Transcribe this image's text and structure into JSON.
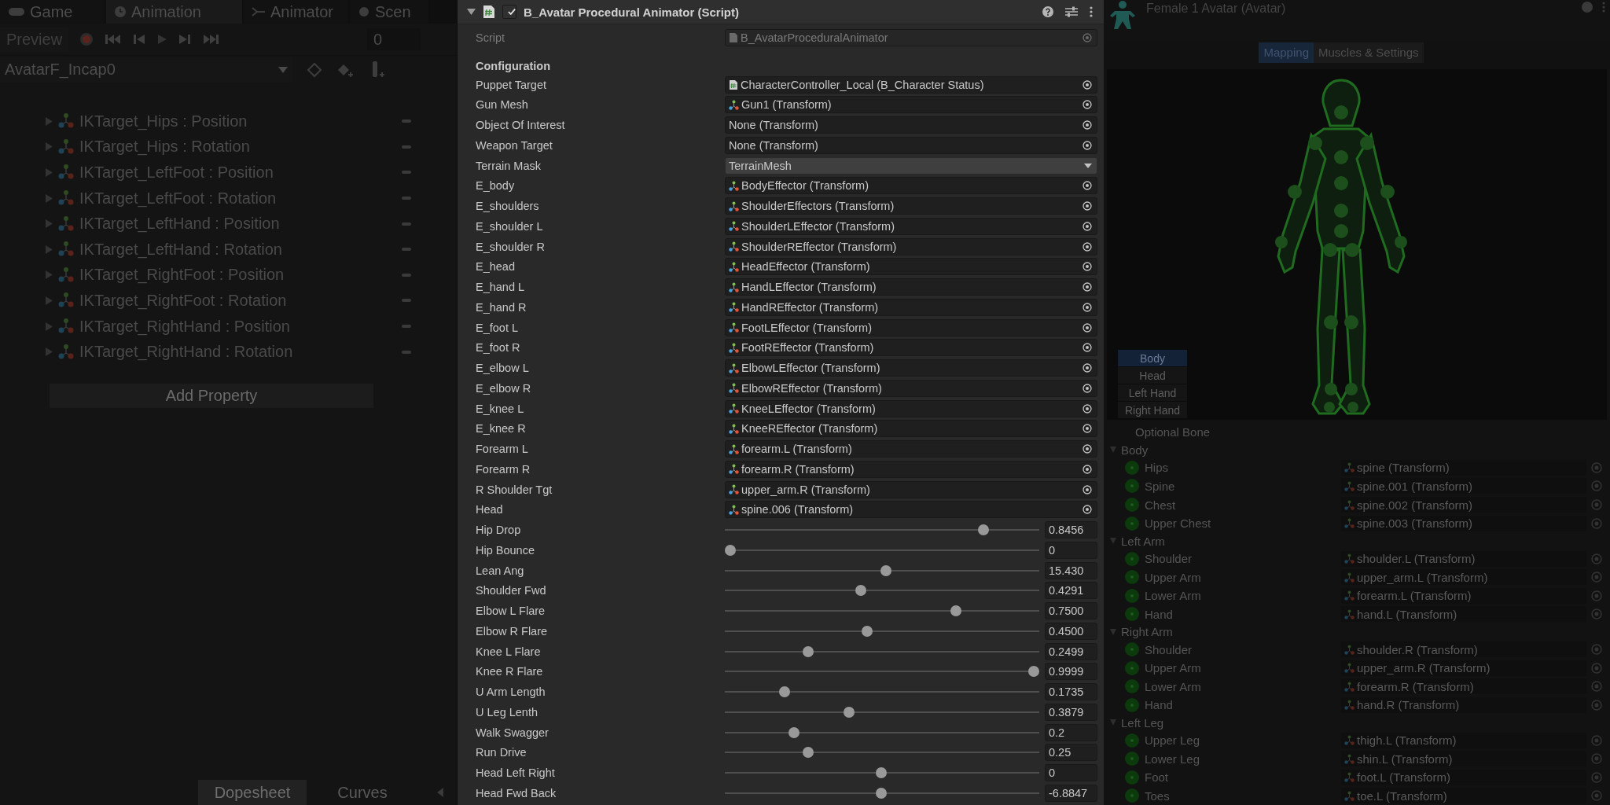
{
  "left_panel": {
    "tabs": [
      {
        "label": "Game",
        "selected": false
      },
      {
        "label": "Animation",
        "selected": true
      },
      {
        "label": "Animator",
        "selected": false
      },
      {
        "label": "Scen",
        "selected": false
      }
    ],
    "preview": "Preview",
    "frame": "0",
    "clip": "AvatarF_Incap0",
    "properties": [
      "IKTarget_Hips : Position",
      "IKTarget_Hips : Rotation",
      "IKTarget_LeftFoot : Position",
      "IKTarget_LeftFoot : Rotation",
      "IKTarget_LeftHand : Position",
      "IKTarget_LeftHand : Rotation",
      "IKTarget_RightFoot : Position",
      "IKTarget_RightFoot : Rotation",
      "IKTarget_RightHand : Position",
      "IKTarget_RightHand : Rotation"
    ],
    "add_property": "Add Property",
    "bottom_tabs": [
      {
        "label": "Dopesheet",
        "selected": true
      },
      {
        "label": "Curves",
        "selected": false
      }
    ]
  },
  "inspector": {
    "title": "B_Avatar Procedural Animator (Script)",
    "enabled": true,
    "script_label": "Script",
    "script_value": "B_AvatarProceduralAnimator",
    "section": "Configuration",
    "fields": [
      {
        "label": "Puppet Target",
        "kind": "script_ref",
        "value": "CharacterController_Local (B_Character Status)"
      },
      {
        "label": "Gun Mesh",
        "kind": "transform_ref",
        "value": "Gun1 (Transform)"
      },
      {
        "label": "Object Of Interest",
        "kind": "ref",
        "value": "None (Transform)"
      },
      {
        "label": "Weapon Target",
        "kind": "ref",
        "value": "None (Transform)"
      },
      {
        "label": "Terrain Mask",
        "kind": "dropdown",
        "value": "TerrainMesh"
      },
      {
        "label": "E_body",
        "kind": "transform_ref",
        "value": "BodyEffector (Transform)"
      },
      {
        "label": "E_shoulders",
        "kind": "transform_ref",
        "value": "ShoulderEffectors (Transform)"
      },
      {
        "label": "E_shoulder L",
        "kind": "transform_ref",
        "value": "ShoulderLEffector (Transform)"
      },
      {
        "label": "E_shoulder R",
        "kind": "transform_ref",
        "value": "ShoulderREffector (Transform)"
      },
      {
        "label": "E_head",
        "kind": "transform_ref",
        "value": "HeadEffector (Transform)"
      },
      {
        "label": "E_hand L",
        "kind": "transform_ref",
        "value": "HandLEffector (Transform)"
      },
      {
        "label": "E_hand R",
        "kind": "transform_ref",
        "value": "HandREffector (Transform)"
      },
      {
        "label": "E_foot L",
        "kind": "transform_ref",
        "value": "FootLEffector (Transform)"
      },
      {
        "label": "E_foot R",
        "kind": "transform_ref",
        "value": "FootREffector (Transform)"
      },
      {
        "label": "E_elbow L",
        "kind": "transform_ref",
        "value": "ElbowLEffector (Transform)"
      },
      {
        "label": "E_elbow R",
        "kind": "transform_ref",
        "value": "ElbowREffector (Transform)"
      },
      {
        "label": "E_knee L",
        "kind": "transform_ref",
        "value": "KneeLEffector (Transform)"
      },
      {
        "label": "E_knee R",
        "kind": "transform_ref",
        "value": "KneeREffector (Transform)"
      },
      {
        "label": "Forearm L",
        "kind": "transform_ref",
        "value": "forearm.L (Transform)"
      },
      {
        "label": "Forearm R",
        "kind": "transform_ref",
        "value": "forearm.R (Transform)"
      },
      {
        "label": "R Shoulder Tgt",
        "kind": "transform_ref",
        "value": "upper_arm.R (Transform)"
      },
      {
        "label": "Head",
        "kind": "transform_ref",
        "value": "spine.006 (Transform)"
      },
      {
        "label": "Hip Drop",
        "kind": "slider",
        "level": 0.833,
        "value": "0.8456"
      },
      {
        "label": "Hip Bounce",
        "kind": "slider",
        "level": 0,
        "value": "0"
      },
      {
        "label": "Lean Ang",
        "kind": "slider",
        "level": 0.513,
        "value": "15.430"
      },
      {
        "label": "Shoulder Fwd",
        "kind": "slider",
        "level": 0.43,
        "value": "0.4291"
      },
      {
        "label": "Elbow L Flare",
        "kind": "slider",
        "level": 0.743,
        "value": "0.7500"
      },
      {
        "label": "Elbow R Flare",
        "kind": "slider",
        "level": 0.45,
        "value": "0.4500"
      },
      {
        "label": "Knee L Flare",
        "kind": "slider",
        "level": 0.257,
        "value": "0.2499"
      },
      {
        "label": "Knee R Flare",
        "kind": "slider",
        "level": 1,
        "value": "0.9999"
      },
      {
        "label": "U Arm Length",
        "kind": "slider",
        "level": 0.18,
        "value": "0.1735"
      },
      {
        "label": "U Leg Lenth",
        "kind": "slider",
        "level": 0.39,
        "value": "0.3879"
      },
      {
        "label": "Walk Swagger",
        "kind": "slider",
        "level": 0.21,
        "value": "0.2"
      },
      {
        "label": "Run Drive",
        "kind": "slider",
        "level": 0.257,
        "value": "0.25"
      },
      {
        "label": "Head Left Right",
        "kind": "slider",
        "level": 0.498,
        "value": "0"
      },
      {
        "label": "Head Fwd Back",
        "kind": "slider",
        "level": 0.498,
        "value": "-6.8847"
      }
    ]
  },
  "right_panel": {
    "title": "Female 1 Avatar (Avatar)",
    "tabs": [
      {
        "label": "Mapping",
        "selected": true
      },
      {
        "label": "Muscles & Settings",
        "selected": false
      }
    ],
    "body_parts": [
      {
        "label": "Body",
        "selected": true
      },
      {
        "label": "Head",
        "selected": false
      },
      {
        "label": "Left Hand",
        "selected": false
      },
      {
        "label": "Right Hand",
        "selected": false
      }
    ],
    "optional_bone": "Optional Bone",
    "groups": [
      {
        "name": "Body",
        "expanded": true,
        "bones": [
          {
            "name": "Hips",
            "value": "spine (Transform)"
          },
          {
            "name": "Spine",
            "value": "spine.001 (Transform)"
          },
          {
            "name": "Chest",
            "value": "spine.002 (Transform)"
          },
          {
            "name": "Upper Chest",
            "value": "spine.003 (Transform)"
          }
        ]
      },
      {
        "name": "Left Arm",
        "expanded": true,
        "bones": [
          {
            "name": "Shoulder",
            "value": "shoulder.L (Transform)"
          },
          {
            "name": "Upper Arm",
            "value": "upper_arm.L (Transform)"
          },
          {
            "name": "Lower Arm",
            "value": "forearm.L (Transform)"
          },
          {
            "name": "Hand",
            "value": "hand.L (Transform)"
          }
        ]
      },
      {
        "name": "Right Arm",
        "expanded": true,
        "bones": [
          {
            "name": "Shoulder",
            "value": "shoulder.R (Transform)"
          },
          {
            "name": "Upper Arm",
            "value": "upper_arm.R (Transform)"
          },
          {
            "name": "Lower Arm",
            "value": "forearm.R (Transform)"
          },
          {
            "name": "Hand",
            "value": "hand.R (Transform)"
          }
        ]
      },
      {
        "name": "Left Leg",
        "expanded": true,
        "bones": [
          {
            "name": "Upper Leg",
            "value": "thigh.L (Transform)"
          },
          {
            "name": "Lower Leg",
            "value": "shin.L (Transform)"
          },
          {
            "name": "Foot",
            "value": "foot.L (Transform)"
          },
          {
            "name": "Toes",
            "value": "toe.L (Transform)"
          }
        ]
      }
    ]
  }
}
